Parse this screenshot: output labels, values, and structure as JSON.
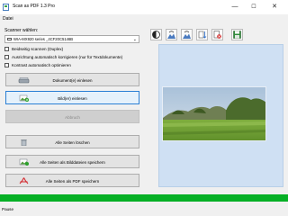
{
  "window": {
    "title": "Scan as PDF 1.3 Pro",
    "minimize_glyph": "—",
    "maximize_glyph": "☐",
    "close_glyph": "✕"
  },
  "menu": {
    "items": [
      {
        "label": "Datei"
      }
    ]
  },
  "scanner": {
    "label": "Scanner wählen:",
    "selected": "WIA-MX920 series _4CF20C5146B",
    "icon": "scanner-icon"
  },
  "options": [
    {
      "label": "Beidseitig scannen (Duplex)",
      "checked": false
    },
    {
      "label": "Ausrichtung automatisch korrigieren (nur für Textdokumente)",
      "checked": false
    },
    {
      "label": "Kontrast automatisch optimieren",
      "checked": false
    }
  ],
  "buttons": {
    "scan_document": {
      "label": "Dokument(e) einlesen",
      "icon": "scanner-icon"
    },
    "scan_image": {
      "label": "Bild(er) einlesen",
      "icon": "add-image-icon",
      "state": "focused"
    },
    "disabled_action": {
      "label": "Abbruch",
      "icon": "",
      "state": "disabled"
    },
    "delete_all": {
      "label": "Alle Seiten löschen",
      "icon": "trash-icon"
    },
    "save_images": {
      "label": "Alle Seiten als Bilddateien speichern",
      "icon": "save-images-icon"
    },
    "save_pdf": {
      "label": "Alle Seiten als PDF speichern",
      "icon": "pdf-icon"
    }
  },
  "toolbar": {
    "icons": [
      "contrast-icon",
      "rotate-left-icon",
      "rotate-right-icon",
      "move-page-icon",
      "delete-page-icon",
      "save-page-icon"
    ]
  },
  "colors": {
    "accent": "#2a7fd4",
    "progress": "#06b025",
    "preview_bg": "#cfe0f3"
  },
  "progress": {
    "value": 1.0
  },
  "status": {
    "text": "Pause"
  }
}
